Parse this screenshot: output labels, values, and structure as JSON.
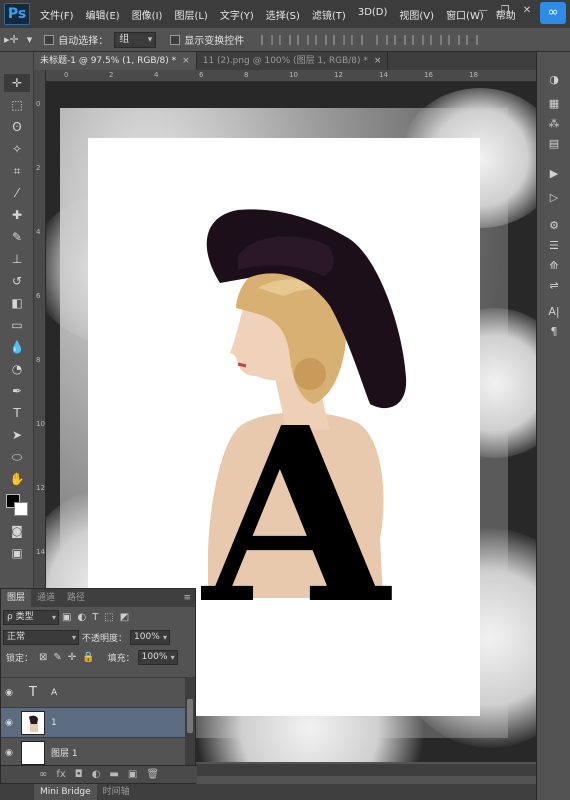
{
  "app": {
    "logo": "Ps"
  },
  "menu": [
    "文件(F)",
    "编辑(E)",
    "图像(I)",
    "图层(L)",
    "文字(Y)",
    "选择(S)",
    "滤镜(T)",
    "3D(D)",
    "视图(V)",
    "窗口(W)",
    "帮助"
  ],
  "window_controls": [
    "—",
    "❐",
    "✕"
  ],
  "options_bar": {
    "move_icon": "move-tool-icon",
    "auto_select_label": "自动选择：",
    "auto_select_value": "组",
    "show_transform_label": "显示变换控件"
  },
  "tabs": [
    {
      "label": "未标题-1 @ 97.5% (1, RGB/8) *",
      "active": true
    },
    {
      "label": "11 (2).png @ 100% (图层 1, RGB/8) *",
      "active": false
    }
  ],
  "tab_close": "×",
  "ruler_h_ticks": [
    "0",
    "2",
    "4",
    "6",
    "8",
    "10",
    "12",
    "14",
    "16",
    "18"
  ],
  "ruler_v_ticks": [
    "0",
    "2",
    "4",
    "6",
    "8",
    "10",
    "12",
    "14"
  ],
  "artwork": {
    "letter": "A"
  },
  "layers_panel": {
    "tabs": [
      "图层",
      "通道",
      "路径"
    ],
    "filter_label": "ρ 类型",
    "blend_mode": "正常",
    "opacity_label": "不透明度：",
    "opacity_value": "100%",
    "lock_label": "锁定：",
    "fill_label": "填充：",
    "fill_value": "100%",
    "layers": [
      {
        "name": "A",
        "type": "text",
        "thumb": "T",
        "selected": false
      },
      {
        "name": "1",
        "type": "image",
        "thumb": "",
        "selected": true
      },
      {
        "name": "图层 1",
        "type": "image",
        "thumb": "",
        "selected": false
      }
    ],
    "footer_icons": [
      "link-icon",
      "fx-icon",
      "mask-icon",
      "adjustment-icon",
      "folder-icon",
      "new-layer-icon",
      "trash-icon"
    ],
    "footer_glyphs": [
      "∞",
      "fx",
      "◘",
      "◐",
      "▬",
      "▣",
      "🗑"
    ]
  },
  "bottom_tabs": [
    {
      "label": "Mini Bridge",
      "active": true
    },
    {
      "label": "时间轴",
      "active": false
    }
  ],
  "colors": {
    "foreground": "#000000",
    "background": "#ffffff",
    "selected_layer": "#5b6b80",
    "accent": "#2d8ce8"
  }
}
